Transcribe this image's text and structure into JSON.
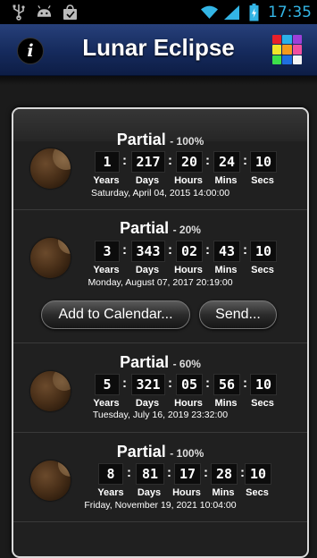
{
  "status": {
    "time": "17:35",
    "left_icons": [
      "usb-icon",
      "android-debug-icon",
      "shopping-bag-icon"
    ],
    "right_icons": [
      "wifi-icon",
      "signal-icon",
      "battery-icon"
    ]
  },
  "header": {
    "title": "Lunar Eclipse",
    "info_glyph": "i",
    "grid_colors": [
      "#e8202a",
      "#2bb0e8",
      "#9e3fd8",
      "#f0e52a",
      "#f39a1d",
      "#f04ea0",
      "#3ce04a",
      "#1f6fe0",
      "#f4f4f4"
    ]
  },
  "units": {
    "years": "Years",
    "days": "Days",
    "hours": "Hours",
    "mins": "Mins",
    "secs": "Secs"
  },
  "actions": {
    "add_to_calendar": "Add to Calendar...",
    "send": "Send..."
  },
  "eclipses": [
    {
      "type": "Partial",
      "percent": "- 100%",
      "years": "1",
      "days": "217",
      "hours": "20",
      "mins": "24",
      "secs": "10",
      "date": "Saturday, April 04, 2015 14:00:00"
    },
    {
      "type": "Partial",
      "percent": "- 20%",
      "years": "3",
      "days": "343",
      "hours": "02",
      "mins": "43",
      "secs": "10",
      "date": "Monday, August 07, 2017 20:19:00"
    },
    {
      "type": "Partial",
      "percent": "- 60%",
      "years": "5",
      "days": "321",
      "hours": "05",
      "mins": "56",
      "secs": "10",
      "date": "Tuesday, July 16, 2019 23:32:00"
    },
    {
      "type": "Partial",
      "percent": "- 100%",
      "years": "8",
      "days": "81",
      "hours": "17",
      "mins": "28",
      "secs": "10",
      "date": "Friday, November 19, 2021 10:04:00"
    }
  ]
}
